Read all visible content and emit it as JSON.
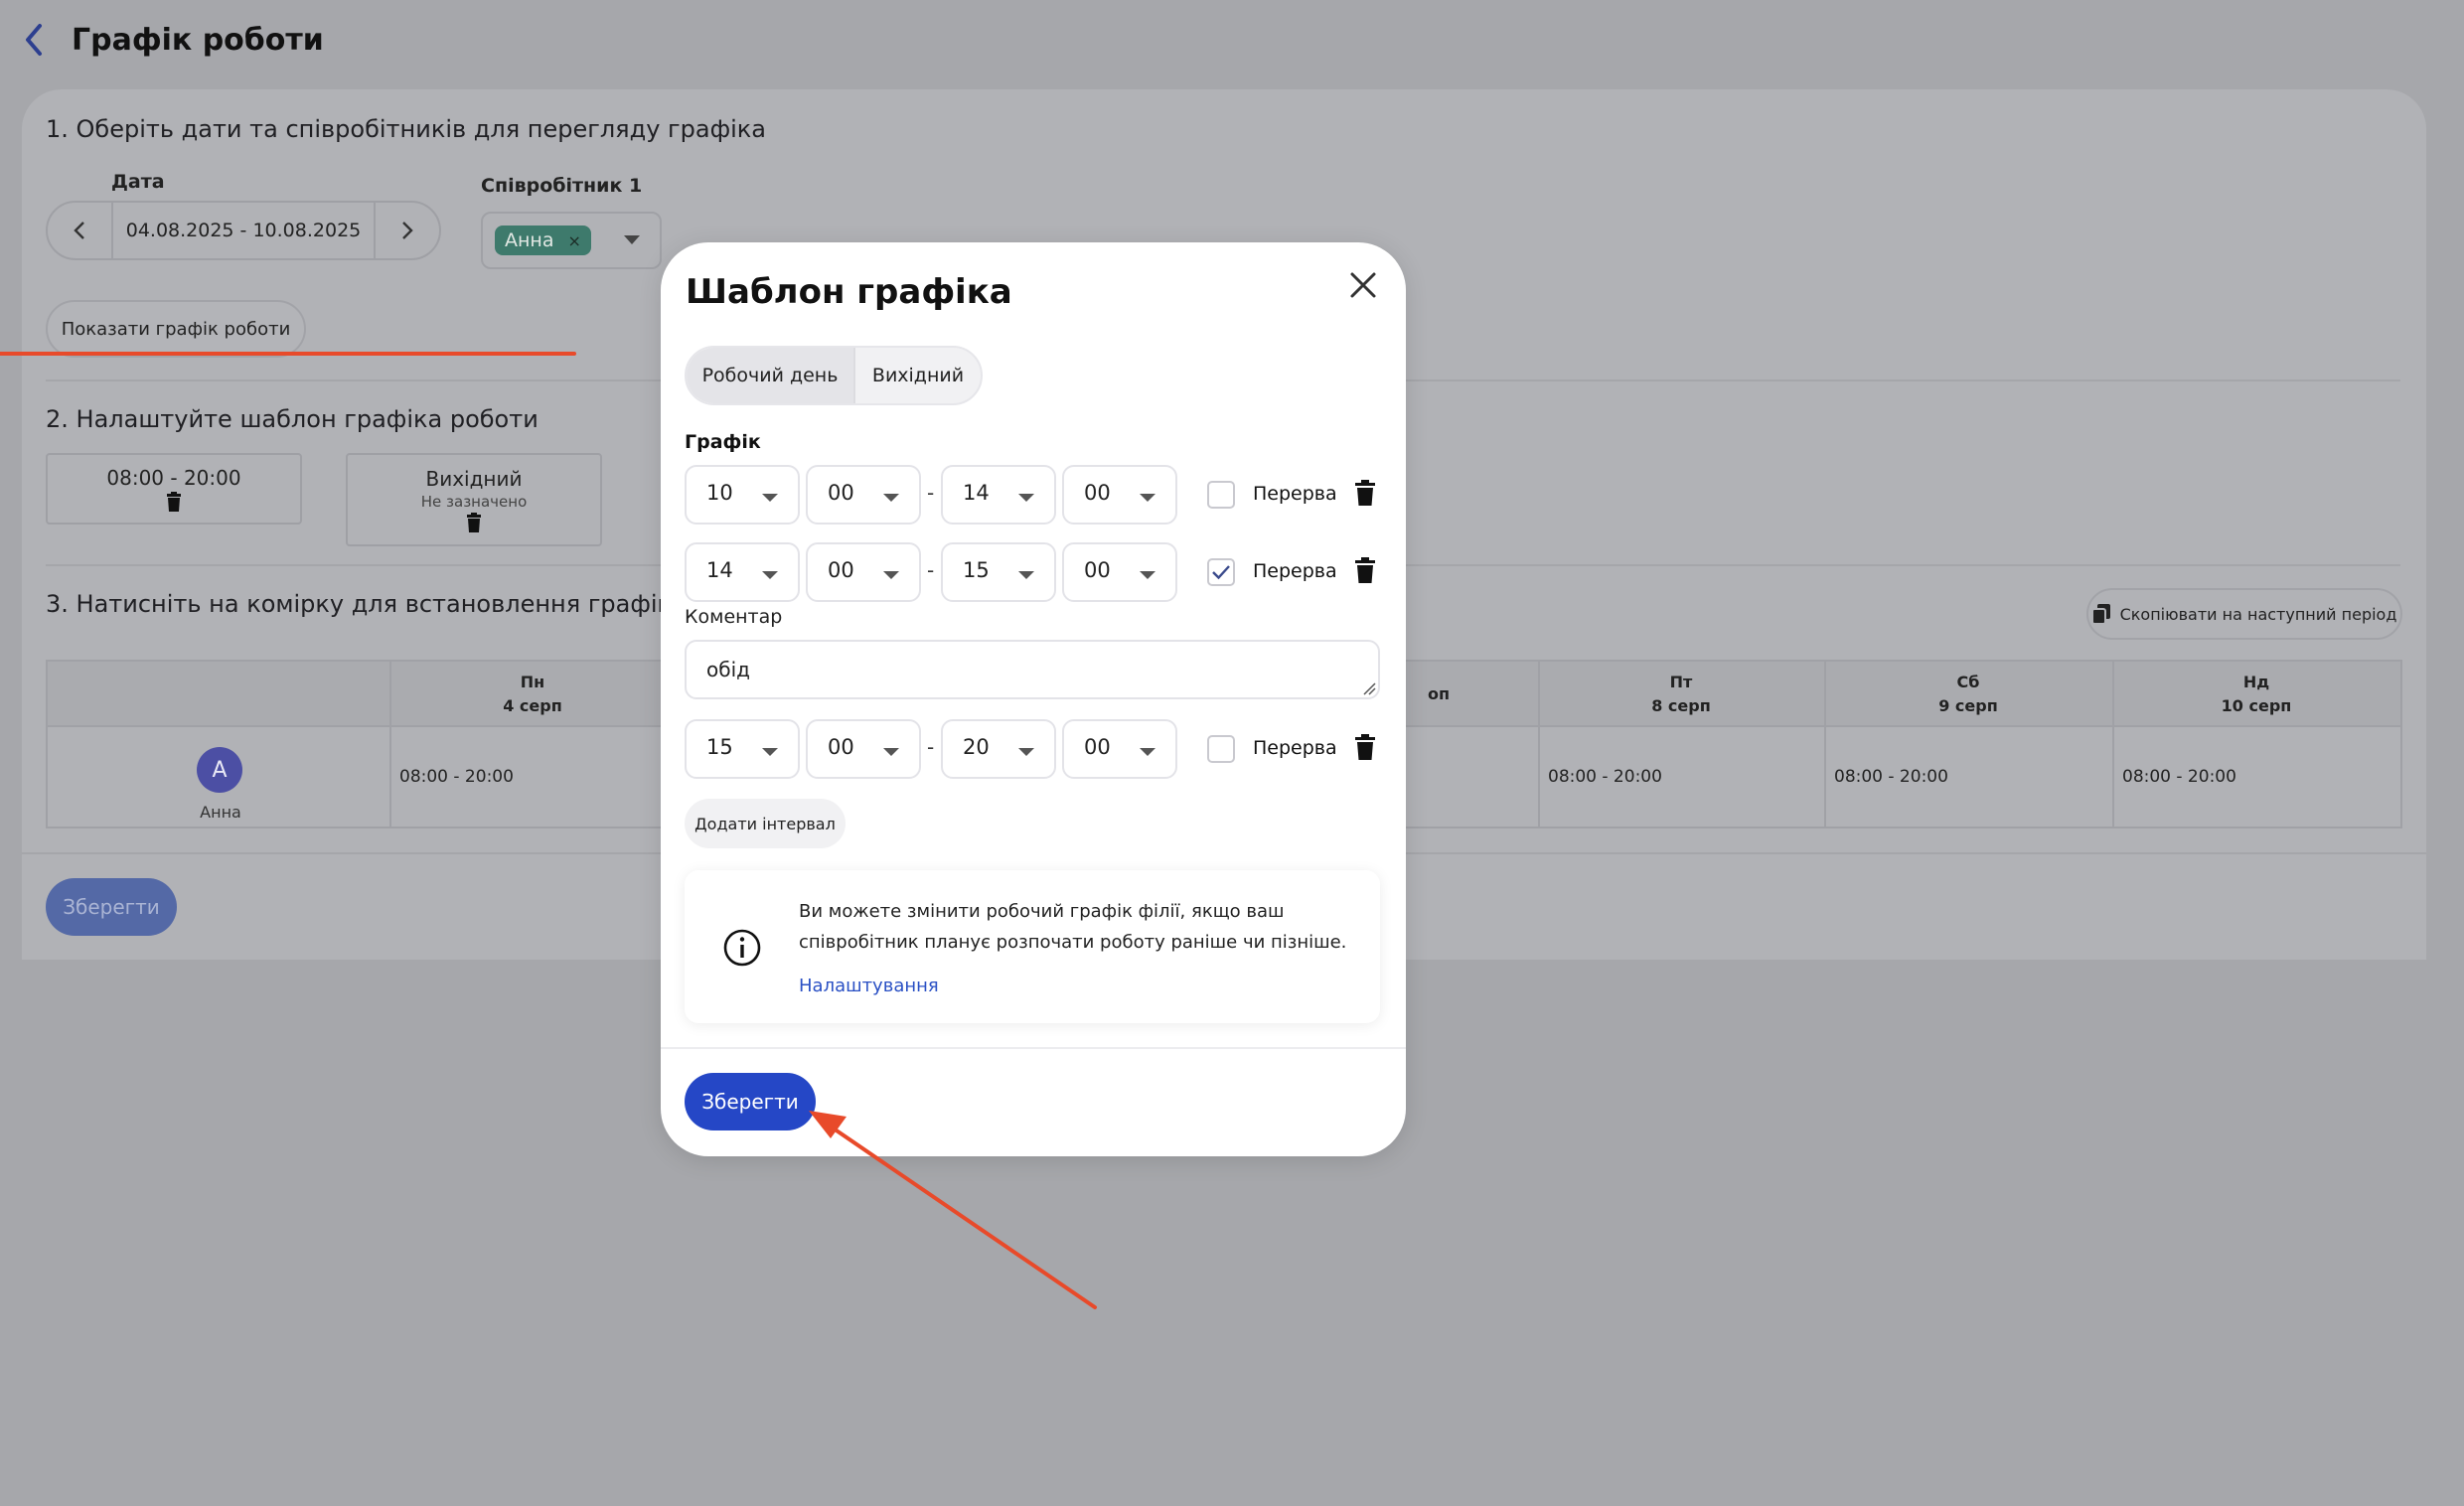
{
  "page": {
    "title": "Графік роботи"
  },
  "section1": {
    "title": "1. Оберіть дати та співробітників для перегляду графіка",
    "date_label": "Дата",
    "date_range": "04.08.2025 - 10.08.2025",
    "employee_label": "Співробітник 1",
    "employee_chip": "Анна",
    "chip_remove": "×",
    "show_button": "Показати графік роботи"
  },
  "section2": {
    "title": "2. Налаштуйте шаблон графіка роботи",
    "templates": [
      {
        "title": "08:00 - 20:00",
        "subtitle": ""
      },
      {
        "title": "Вихідний",
        "subtitle": "Не зазначено"
      }
    ]
  },
  "section3": {
    "title": "3. Натисніть на комірку для встановлення графіка",
    "copy_button": "Скопіювати на наступний період",
    "days": [
      {
        "day": "Пн",
        "date": "4 серп"
      },
      {
        "day": "",
        "date": ""
      },
      {
        "day": "",
        "date": "оп"
      },
      {
        "day": "Пт",
        "date": "8 серп"
      },
      {
        "day": "Сб",
        "date": "9 серп"
      },
      {
        "day": "Нд",
        "date": "10 серп"
      }
    ],
    "employee": {
      "initial": "A",
      "name": "Анна"
    },
    "cells": [
      "08:00 - 20:00",
      "08:00 - 20:00",
      "08:00 - 20:00",
      "08:00 - 20:00"
    ]
  },
  "background_save": "Зберегти",
  "modal": {
    "title": "Шаблон графіка",
    "tabs": [
      "Робочий день",
      "Вихідний"
    ],
    "active_tab": "Робочий день",
    "schedule_label": "Графік",
    "intervals": [
      {
        "from_h": "10",
        "from_m": "00",
        "to_h": "14",
        "to_m": "00",
        "break": false,
        "break_label": "Перерва"
      },
      {
        "from_h": "14",
        "from_m": "00",
        "to_h": "15",
        "to_m": "00",
        "break": true,
        "break_label": "Перерва"
      },
      {
        "from_h": "15",
        "from_m": "00",
        "to_h": "20",
        "to_m": "00",
        "break": false,
        "break_label": "Перерва"
      }
    ],
    "separator": "-",
    "comment_label": "Коментар",
    "comment_value": "обід",
    "add_interval": "Додати інтервал",
    "info_text": "Ви можете змінити робочий графік філії, якщо ваш співробітник планує розпочати роботу раніше чи пізніше.",
    "info_link": "Налаштування",
    "save": "Зберегти"
  },
  "colors": {
    "accent": "#2547c6",
    "annotation": "#e84a2a",
    "chip": "#3e7a6c",
    "avatar": "#4c4fa4"
  }
}
